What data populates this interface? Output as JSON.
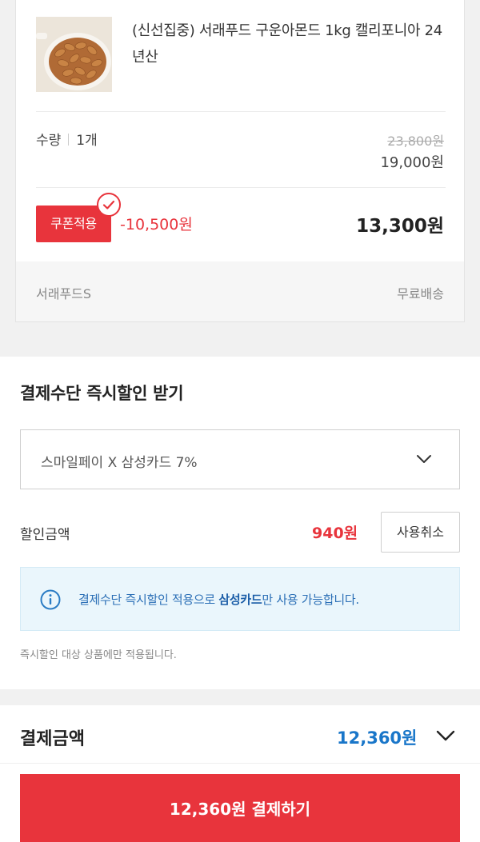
{
  "product": {
    "name": "(신선집중) 서래푸드 구운아몬드 1kg 캘리포니아 24년산",
    "quantity_label": "수량",
    "quantity_value": "1개",
    "original_price": "23,800원",
    "sale_price": "19,000원",
    "coupon_label": "쿠폰적용",
    "coupon_discount": "-10,500원",
    "final_price": "13,300원",
    "seller": "서래푸드S",
    "shipping": "무료배송"
  },
  "instant_discount": {
    "title": "결제수단 즉시할인 받기",
    "selected_method": "스마일페이 X 삼성카드 7%",
    "discount_label": "할인금액",
    "discount_amount": "940원",
    "cancel_label": "사용취소",
    "notice_prefix": "결제수단 즉시할인 적용으로 ",
    "notice_highlight": "삼성카드",
    "notice_suffix": "만 사용 가능합니다.",
    "footnote": "즉시할인 대상 상품에만 적용됩니다."
  },
  "payment": {
    "total_label": "결제금액",
    "total_amount": "12,360원",
    "pay_button_label": "12,360원 결제하기"
  },
  "colors": {
    "accent_red": "#e8343c",
    "accent_blue": "#1976c9",
    "info_bg": "#eaf6fc"
  },
  "icons": [
    "check-circle-icon",
    "chevron-down-icon",
    "info-icon"
  ]
}
